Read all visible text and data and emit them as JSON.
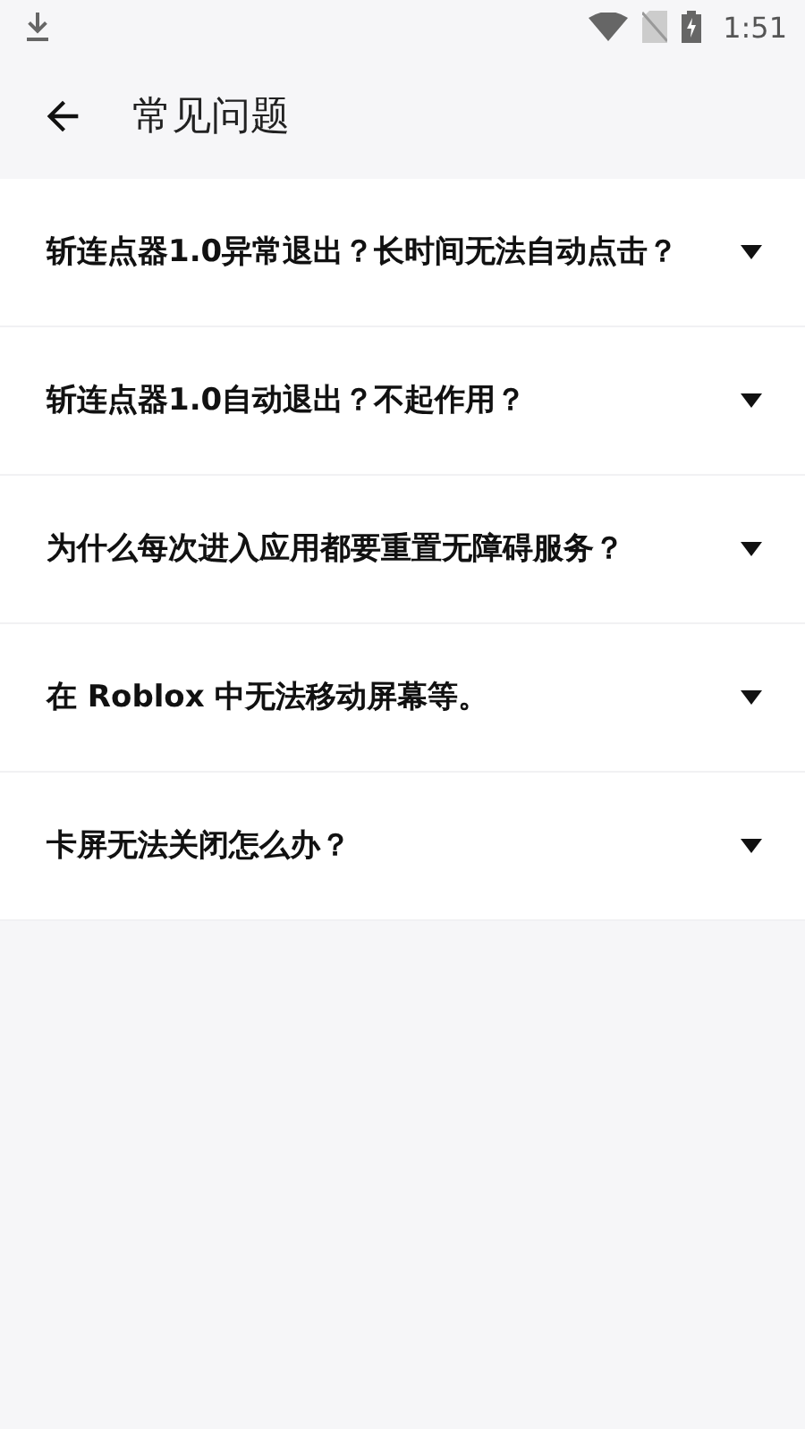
{
  "status_bar": {
    "time": "1:51"
  },
  "app_bar": {
    "title": "常见问题"
  },
  "faq_items": [
    {
      "question": "斩连点器1.0异常退出？长时间无法自动点击？",
      "expanded": false
    },
    {
      "question": "斩连点器1.0自动退出？不起作用？",
      "expanded": false
    },
    {
      "question": "为什么每次进入应用都要重置无障碍服务？",
      "expanded": false
    },
    {
      "question": "在 Roblox 中无法移动屏幕等。",
      "expanded": false
    },
    {
      "question": "卡屏无法关闭怎么办？",
      "expanded": false
    }
  ]
}
